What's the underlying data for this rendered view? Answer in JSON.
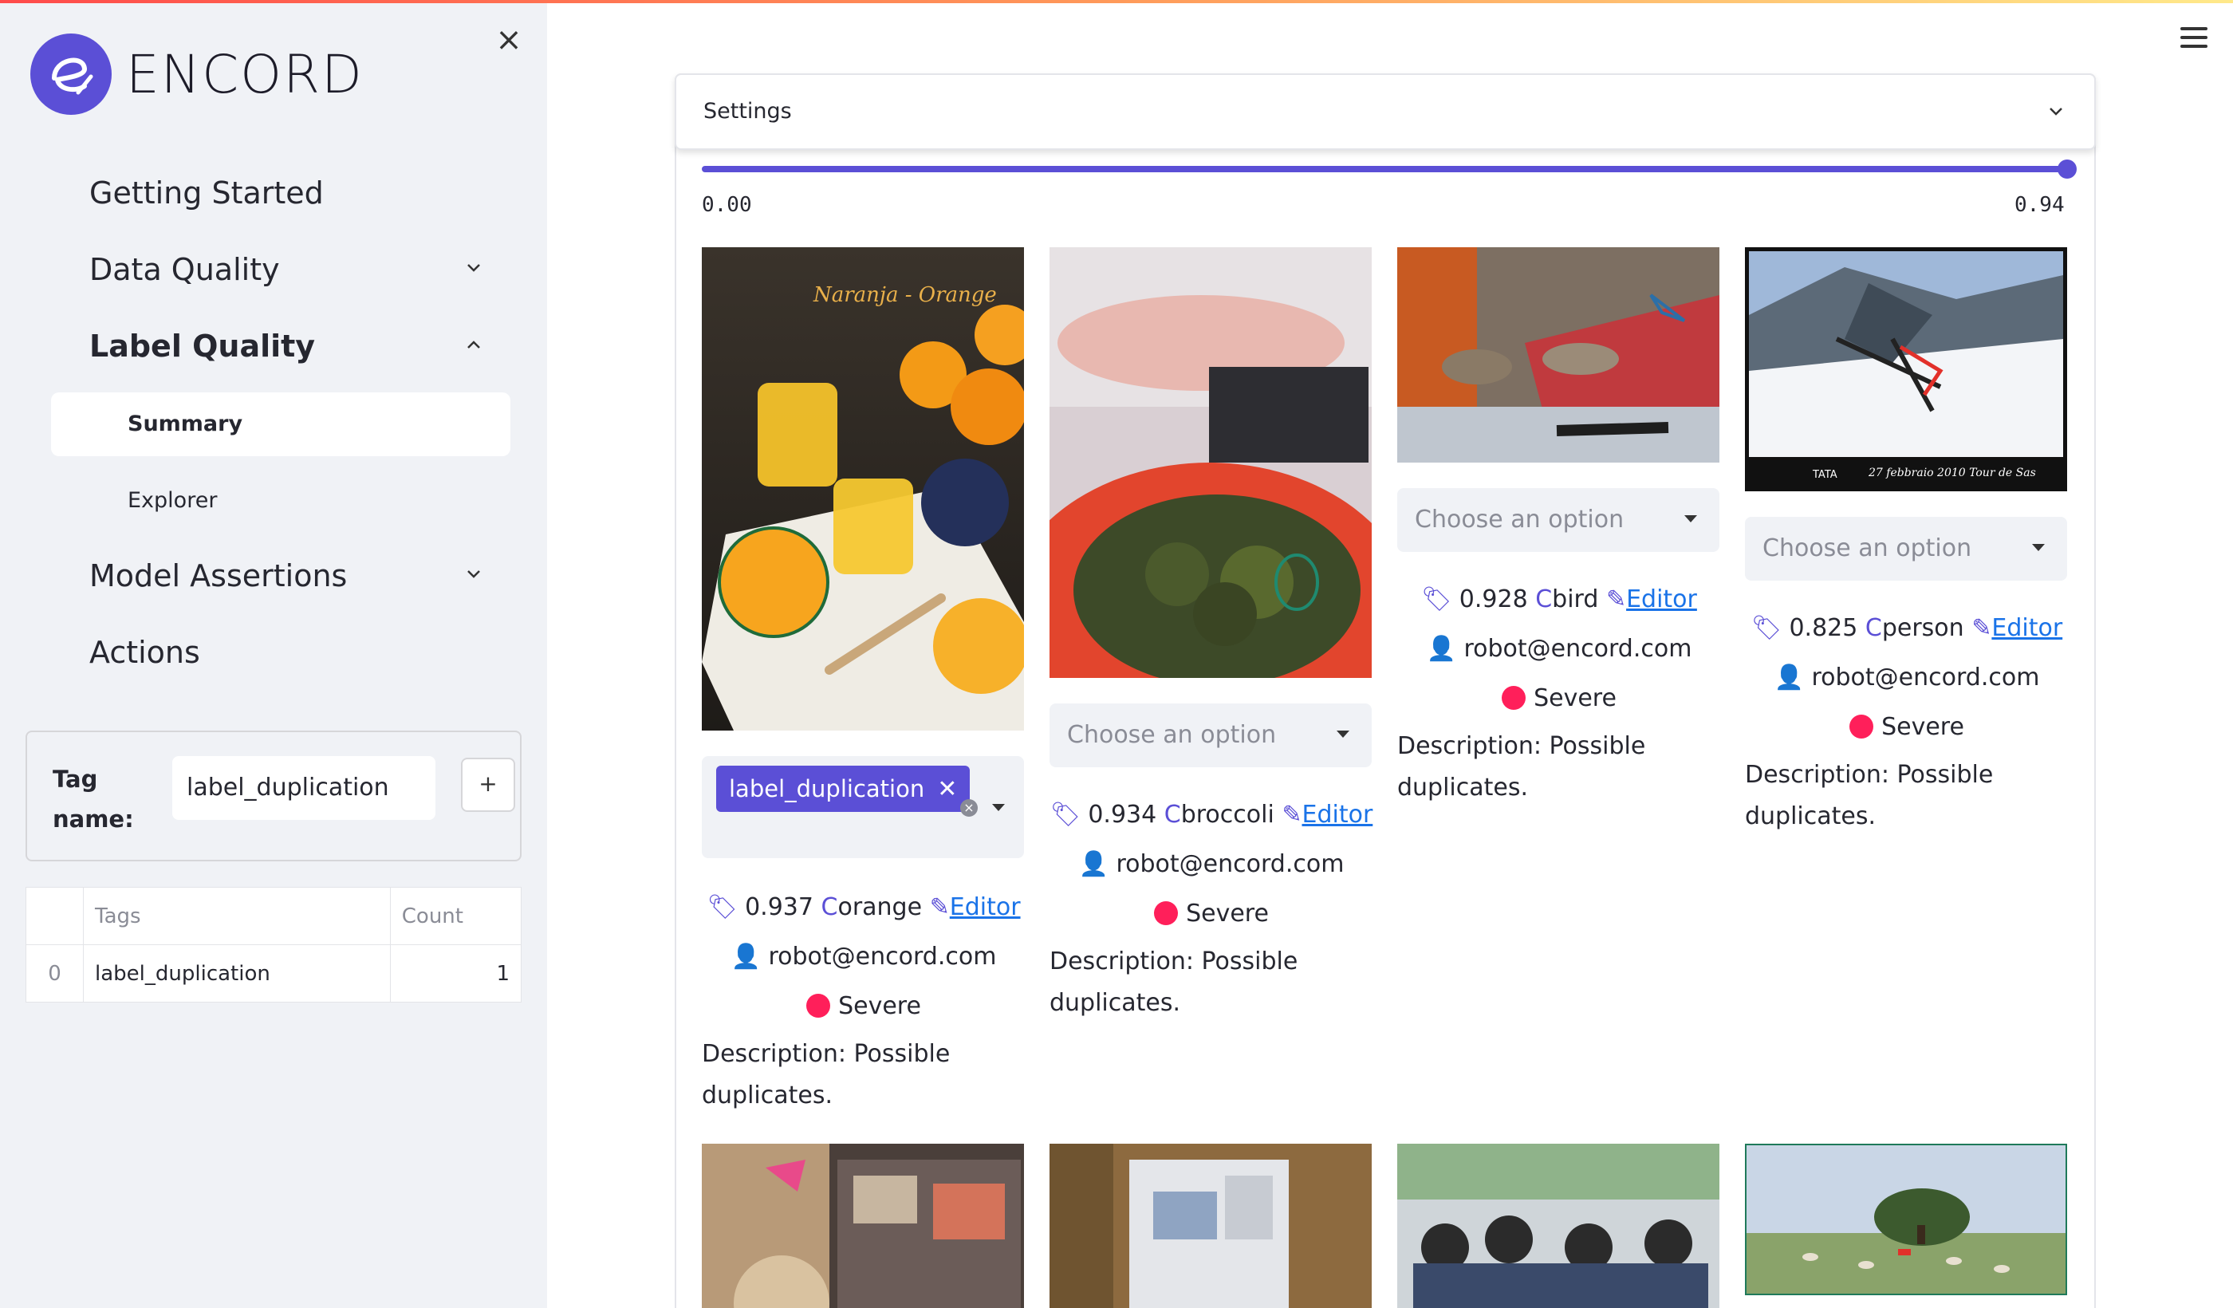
{
  "app": {
    "brand": "ENCORD",
    "accent_color": "#5b4fd6",
    "severity_color": "#ff1f5a"
  },
  "sidebar": {
    "nav": [
      {
        "label": "Getting Started"
      },
      {
        "label": "Data Quality"
      },
      {
        "label": "Label Quality"
      },
      {
        "label": "Model Assertions"
      },
      {
        "label": "Actions"
      }
    ],
    "sub": [
      {
        "label": "Summary"
      },
      {
        "label": "Explorer"
      }
    ],
    "tag": {
      "label": "Tag name:",
      "value": "label_duplication",
      "add_label": "+"
    },
    "table": {
      "headers": [
        "",
        "Tags",
        "Count"
      ],
      "rows": [
        {
          "idx": "0",
          "tag": "label_duplication",
          "count": "1"
        }
      ]
    }
  },
  "main": {
    "settings_label": "Settings",
    "slider": {
      "min_label": "0.00",
      "max_label": "0.94",
      "low": 0.0,
      "high": 0.94
    },
    "select_placeholder": "Choose an option",
    "cards": [
      {
        "score": "0.937",
        "class": "orange",
        "editor": "Editor",
        "user": "robot@encord.com",
        "severity": "Severe",
        "description": "Description: Possible duplicates.",
        "selected_tag": "label_duplication",
        "chip_close": "✕"
      },
      {
        "score": "0.934",
        "class": "broccoli",
        "editor": "Editor",
        "user": "robot@encord.com",
        "severity": "Severe",
        "description": "Description: Possible duplicates."
      },
      {
        "score": "0.928",
        "class": "bird",
        "editor": "Editor",
        "user": "robot@encord.com",
        "severity": "Severe",
        "description": "Description: Possible duplicates."
      },
      {
        "score": "0.825",
        "class": "person",
        "editor": "Editor",
        "user": "robot@encord.com",
        "severity": "Severe",
        "description": "Description: Possible duplicates."
      }
    ],
    "image_overlays": {
      "card0_title": "Naranja - Orange",
      "card3_caption": "27 febbraio 2010 Tour de Sas",
      "card3_logo": "TATA"
    }
  }
}
